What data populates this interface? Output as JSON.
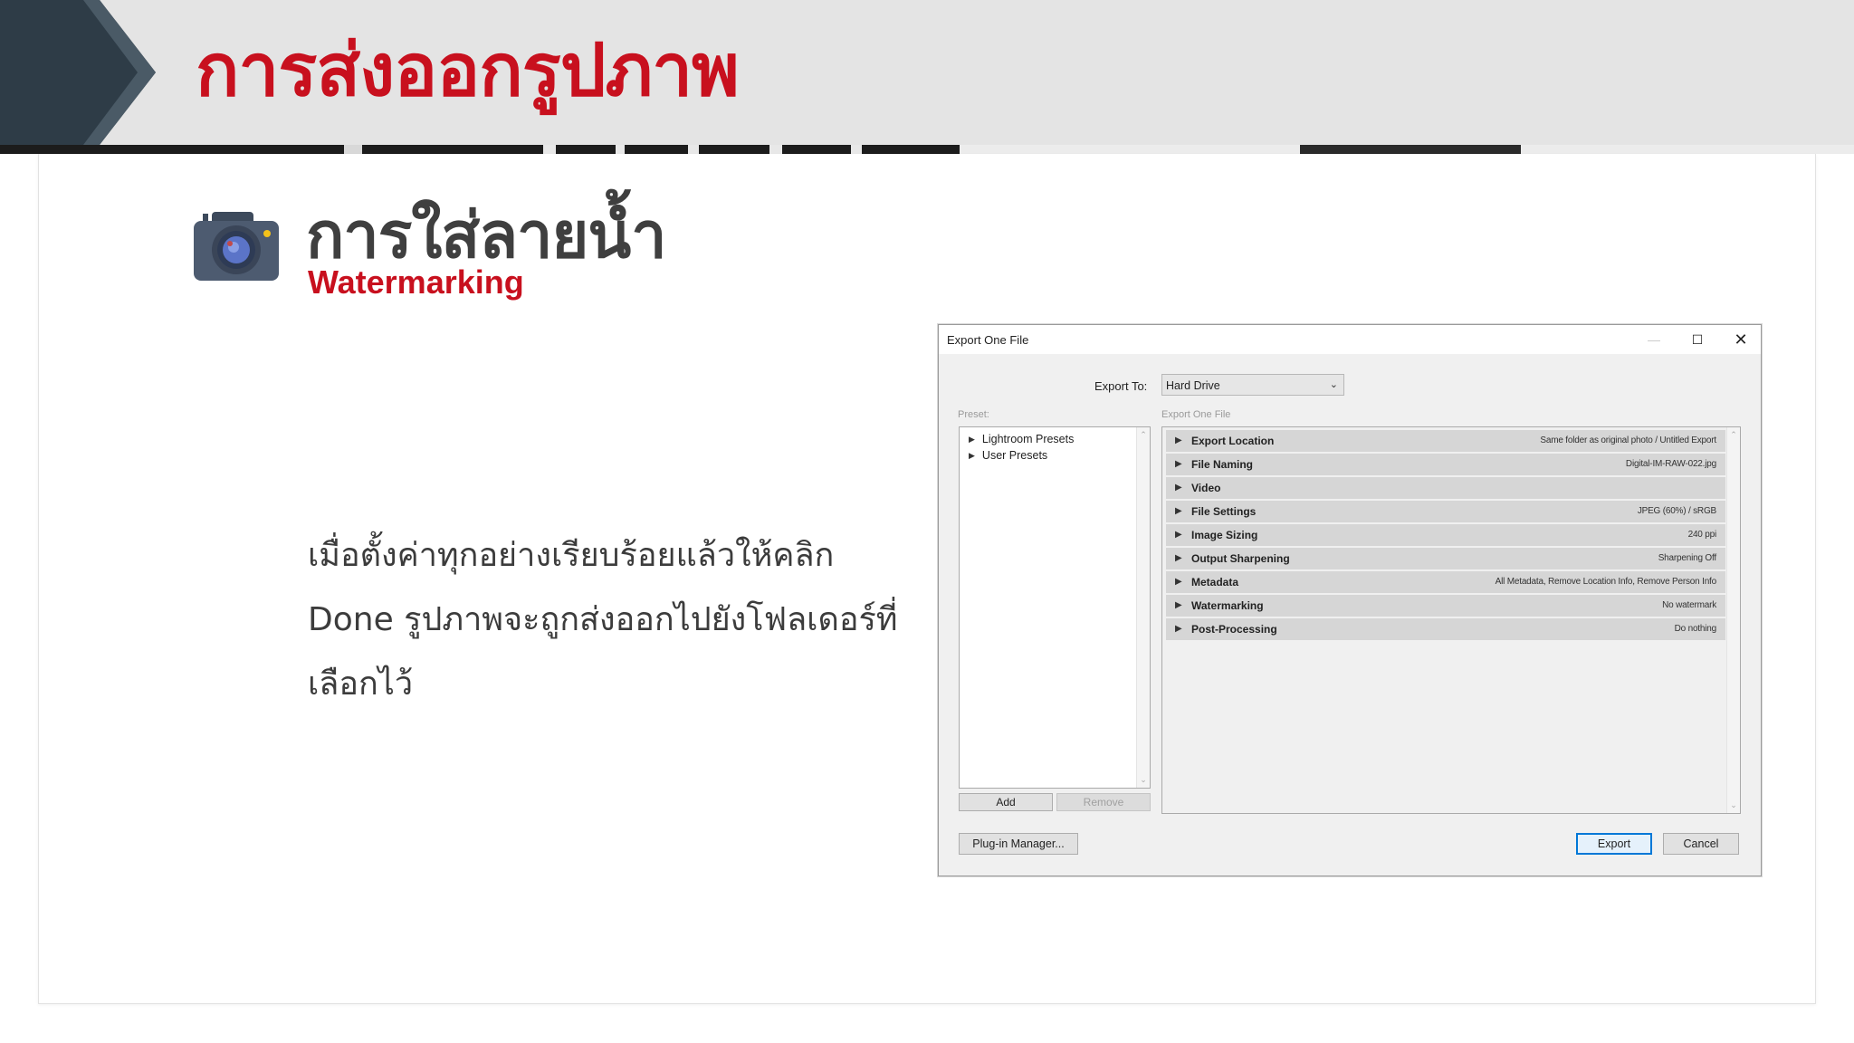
{
  "slide": {
    "header_title": "การส่งออกรูปภาพ",
    "section_title": "การใส่ลายน้ำ",
    "section_subtitle": "Watermarking",
    "body_lines": [
      "เมื่อตั้งค่าทุกอย่างเรียบร้อยแล้วให้คลิก",
      "Done รูปภาพจะถูกส่งออกไปยังโฟลเดอร์ที่",
      "เลือกไว้"
    ],
    "colors": {
      "accent_red": "#c8101e",
      "dark_navy": "#2e3c47",
      "header_gray": "#e4e4e4"
    }
  },
  "dialog": {
    "title": "Export One File",
    "window_buttons": {
      "minimize": "—",
      "maximize": "☐",
      "close": "✕"
    },
    "export_to_label": "Export To:",
    "export_to_value": "Hard Drive",
    "preset_label": "Preset:",
    "export_file_label": "Export One File",
    "presets": [
      "Lightroom Presets",
      "User Presets"
    ],
    "add_button": "Add",
    "remove_button": "Remove",
    "sections": [
      {
        "name": "Export Location",
        "value": "Same folder as original photo / Untitled Export"
      },
      {
        "name": "File Naming",
        "value": "Digital-IM-RAW-022.jpg"
      },
      {
        "name": "Video",
        "value": ""
      },
      {
        "name": "File Settings",
        "value": "JPEG (60%) / sRGB"
      },
      {
        "name": "Image Sizing",
        "value": "240 ppi"
      },
      {
        "name": "Output Sharpening",
        "value": "Sharpening Off"
      },
      {
        "name": "Metadata",
        "value": "All Metadata, Remove Location Info, Remove Person Info"
      },
      {
        "name": "Watermarking",
        "value": "No watermark"
      },
      {
        "name": "Post-Processing",
        "value": "Do nothing"
      }
    ],
    "plugin_manager_button": "Plug-in Manager...",
    "export_button": "Export",
    "cancel_button": "Cancel"
  }
}
